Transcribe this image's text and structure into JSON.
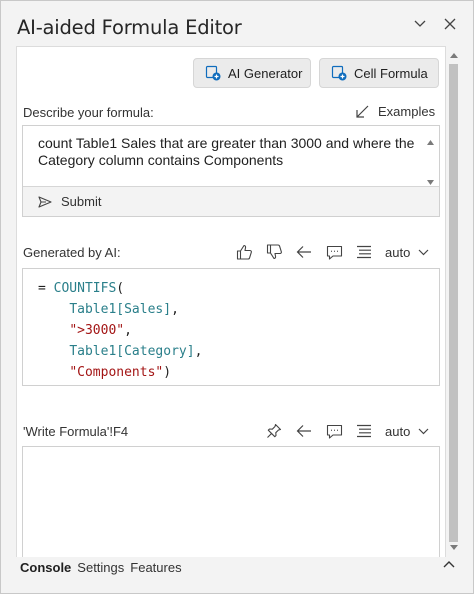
{
  "window": {
    "title": "AI-aided Formula Editor"
  },
  "modes": {
    "ai_generator": "AI Generator",
    "cell_formula": "Cell Formula"
  },
  "prompt": {
    "label": "Describe your formula:",
    "examples_label": "Examples",
    "text": "count Table1 Sales that are greater than 3000 and where the Category column contains Components",
    "submit_label": "Submit"
  },
  "generated": {
    "label": "Generated by AI:",
    "format_value": "auto",
    "formula_lines": [
      {
        "prefix": "= ",
        "tokens": [
          {
            "t": "COUNTIFS",
            "k": "fn"
          },
          {
            "t": "(",
            "k": "punc"
          }
        ]
      },
      {
        "prefix": "    ",
        "tokens": [
          {
            "t": "Table1",
            "k": "ref"
          },
          {
            "t": "[Sales]",
            "k": "ref"
          },
          {
            "t": ",",
            "k": "punc"
          }
        ]
      },
      {
        "prefix": "    ",
        "tokens": [
          {
            "t": "\">3000\"",
            "k": "str"
          },
          {
            "t": ",",
            "k": "punc"
          }
        ]
      },
      {
        "prefix": "    ",
        "tokens": [
          {
            "t": "Table1",
            "k": "ref"
          },
          {
            "t": "[Category]",
            "k": "ref"
          },
          {
            "t": ",",
            "k": "punc"
          }
        ]
      },
      {
        "prefix": "    ",
        "tokens": [
          {
            "t": "\"Components\"",
            "k": "str"
          },
          {
            "t": ")",
            "k": "punc"
          }
        ]
      }
    ]
  },
  "target": {
    "label": "'Write Formula'!F4",
    "format_value": "auto",
    "content": ""
  },
  "bottom_tabs": [
    {
      "label": "Console",
      "active": true
    },
    {
      "label": "Settings",
      "active": false
    },
    {
      "label": "Features",
      "active": false
    }
  ],
  "icons": {
    "chevron": "chevron-down-icon",
    "close": "close-icon",
    "ai_generator": "new-formula-icon",
    "cell_formula": "cell-formula-icon",
    "examples": "arrow-down-left-icon",
    "submit": "send-icon",
    "thumbs_up": "thumbs-up-icon",
    "thumbs_down": "thumbs-down-icon",
    "insert": "arrow-left-icon",
    "comment": "comment-icon",
    "format": "align-lines-icon",
    "pin": "pin-icon",
    "collapse": "chevron-up-icon"
  },
  "colors": {
    "function": "#2a7f8a",
    "string": "#a31515",
    "accent": "#0f6cbd"
  }
}
